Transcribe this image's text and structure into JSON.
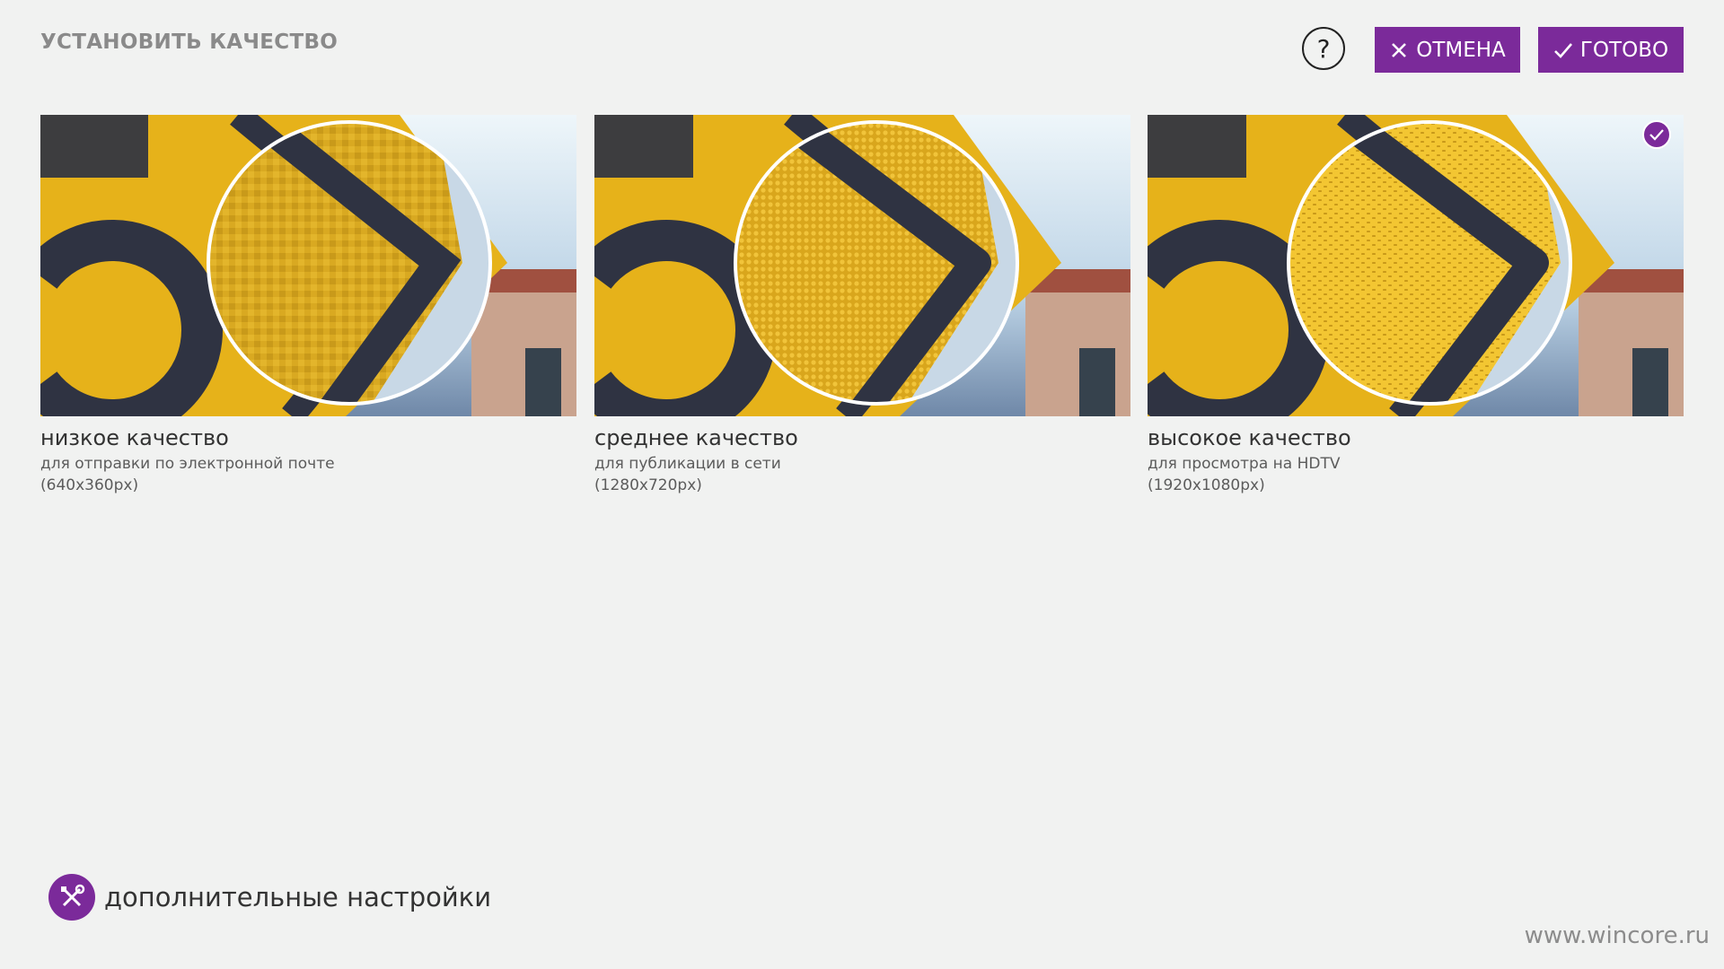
{
  "header": {
    "title": "УСТАНОВИТЬ КАЧЕСТВО",
    "help_label": "?",
    "cancel_label": "ОТМЕНА",
    "done_label": "ГОТОВО"
  },
  "qualities": [
    {
      "title": "низкое качество",
      "description": "для отправки по электронной почте",
      "resolution": "(640x360px)",
      "selected": false
    },
    {
      "title": "среднее качество",
      "description": "для публикации в сети",
      "resolution": "(1280x720px)",
      "selected": false
    },
    {
      "title": "высокое качество",
      "description": "для просмотра на HDTV",
      "resolution": "(1920x1080px)",
      "selected": true
    }
  ],
  "footer": {
    "more_settings_label": "дополнительные настройки",
    "watermark": "www.wincore.ru"
  },
  "colors": {
    "accent": "#7b2a9a",
    "background": "#f1f2f1",
    "sign_yellow": "#e6b21a"
  },
  "icons": {
    "help": "question-icon",
    "cancel": "close-icon",
    "done": "checkmark-icon",
    "selected": "check-badge-icon",
    "more_settings": "tools-icon"
  }
}
